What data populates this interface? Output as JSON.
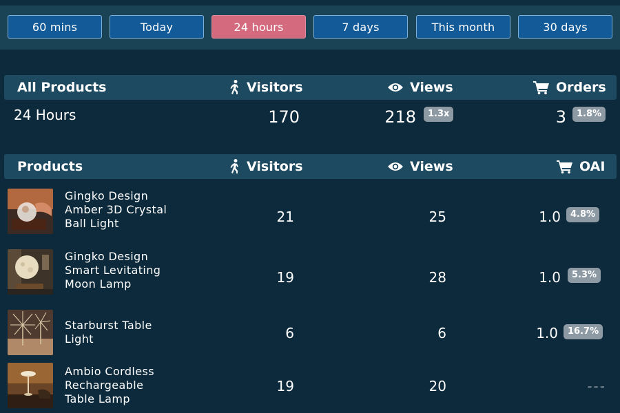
{
  "range_buttons": [
    {
      "label": "60 mins",
      "active": false
    },
    {
      "label": "Today",
      "active": false
    },
    {
      "label": "24 hours",
      "active": true
    },
    {
      "label": "7 days",
      "active": false
    },
    {
      "label": "This month",
      "active": false
    },
    {
      "label": "30 days",
      "active": false
    }
  ],
  "summary_header": {
    "title": "All Products",
    "visitors": "Visitors",
    "views": "Views",
    "orders": "Orders"
  },
  "summary": {
    "label": "24 Hours",
    "visitors": "170",
    "views": "218",
    "views_badge": "1.3x",
    "orders": "3",
    "orders_badge": "1.8%"
  },
  "products_header": {
    "title": "Products",
    "visitors": "Visitors",
    "views": "Views",
    "oai": "OAI"
  },
  "products": [
    {
      "name": "Gingko Design Amber 3D Crystal Ball Light",
      "visitors": "21",
      "views": "25",
      "oai": "1.0",
      "oai_badge": "4.8%"
    },
    {
      "name": "Gingko Design Smart Levitating Moon Lamp",
      "visitors": "19",
      "views": "28",
      "oai": "1.0",
      "oai_badge": "5.3%"
    },
    {
      "name": "Starburst Table Light",
      "visitors": "6",
      "views": "6",
      "oai": "1.0",
      "oai_badge": "16.7%"
    },
    {
      "name": "Ambio Cordless Rechargeable Table Lamp",
      "visitors": "19",
      "views": "20",
      "oai": "---"
    }
  ],
  "icons": {
    "visitors": "walking-person-icon",
    "views": "eye-icon",
    "orders": "shopping-cart-icon"
  },
  "colors": {
    "background": "#0c2a3b",
    "range_bar": "#1b4356",
    "button": "#135a98",
    "button_active": "#d46a7e",
    "header_row": "#1d4a60",
    "badge": "#8d9aa3"
  }
}
